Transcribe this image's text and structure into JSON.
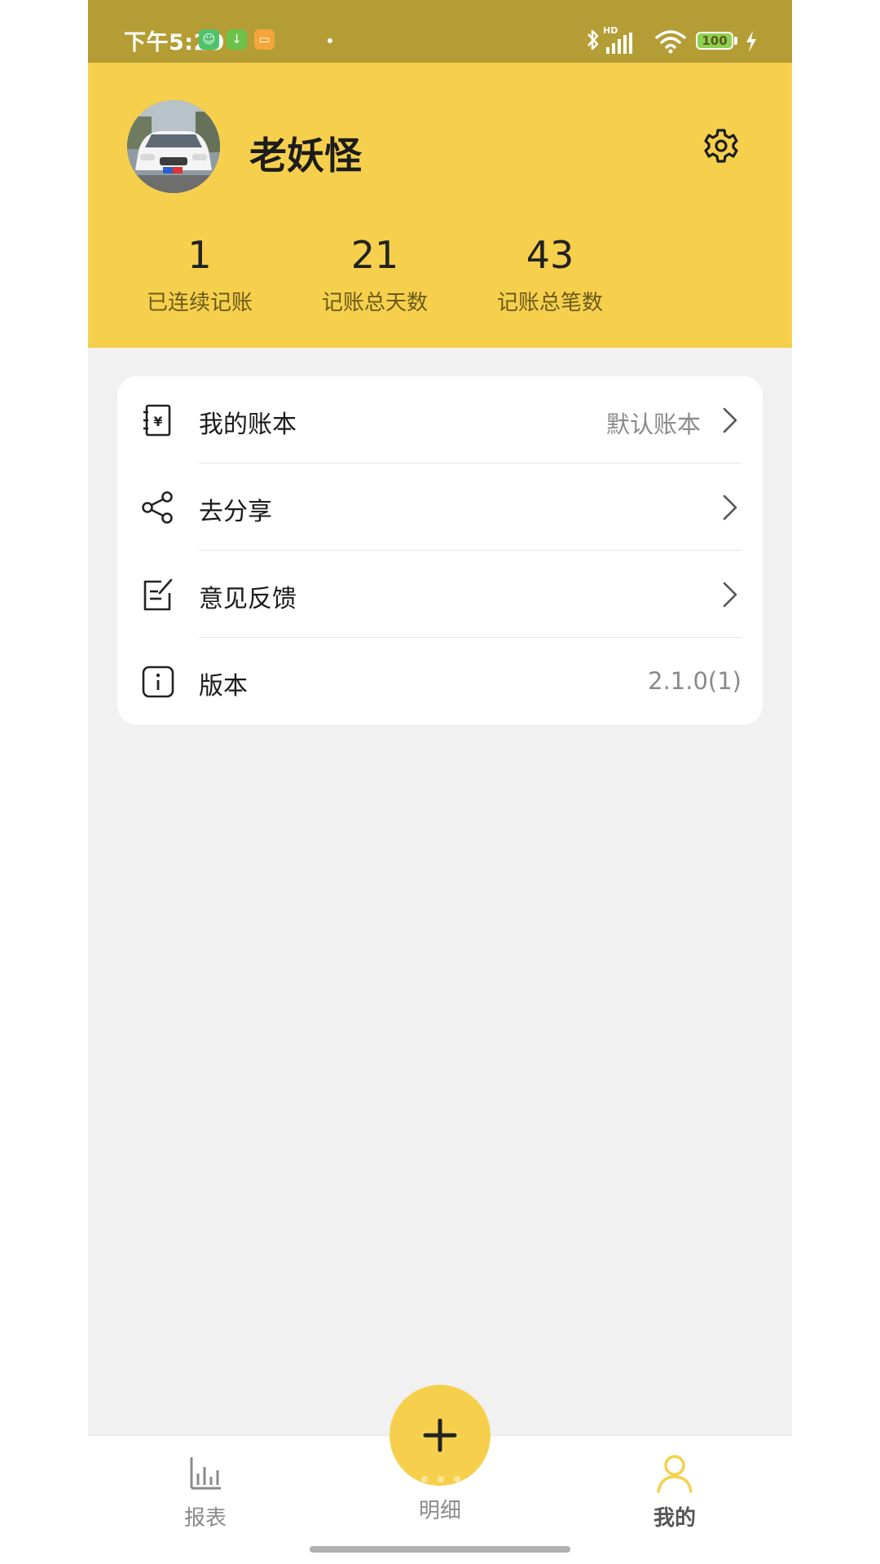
{
  "status_bar": {
    "time": "下午5:29",
    "notification_icons": [
      "cat-app-icon",
      "download-icon",
      "message-icon"
    ],
    "battery": "100",
    "signal": "HD"
  },
  "profile": {
    "name": "老妖怪",
    "avatar": "car-photo-avatar",
    "settings_icon": "gear-icon"
  },
  "stats": [
    {
      "value": "1",
      "label": "已连续记账"
    },
    {
      "value": "21",
      "label": "记账总天数"
    },
    {
      "value": "43",
      "label": "记账总笔数"
    }
  ],
  "menu": [
    {
      "icon": "ledger-icon",
      "label": "我的账本",
      "value": "默认账本",
      "arrow": true
    },
    {
      "icon": "share-icon",
      "label": "去分享",
      "value": "",
      "arrow": true
    },
    {
      "icon": "feedback-icon",
      "label": "意见反馈",
      "value": "",
      "arrow": true
    },
    {
      "icon": "info-icon",
      "label": "版本",
      "value": "2.1.0(1)",
      "arrow": false
    }
  ],
  "bottom_nav": {
    "report": "报表",
    "detail": "明细",
    "mine": "我的",
    "active": "mine"
  },
  "colors": {
    "header": "#f6d04d",
    "status_bar": "#b49d35",
    "background": "#f1f1f1",
    "accent": "#f6d04d"
  }
}
